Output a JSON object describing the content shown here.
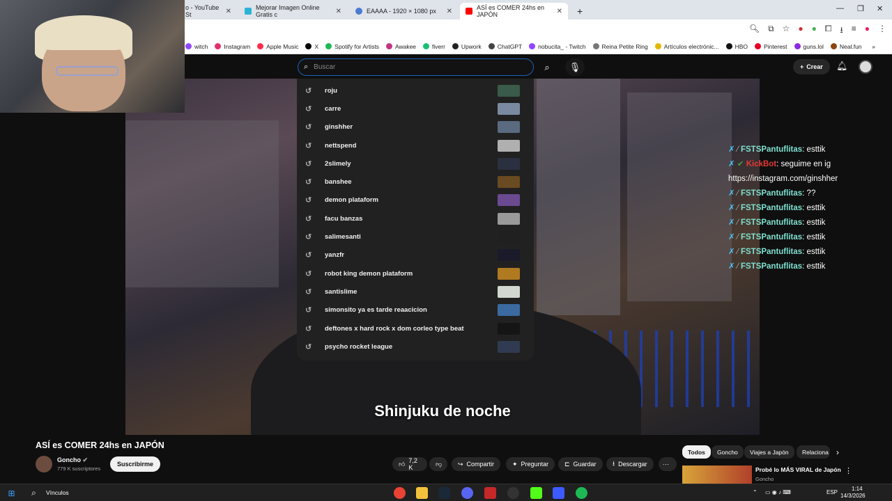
{
  "browser": {
    "tabs": [
      {
        "label": "o - YouTube St",
        "icon": "youtube-studio-icon",
        "color": "#ff0000"
      },
      {
        "label": "Mejorar Imagen Online Gratis c",
        "icon": "image-icon",
        "color": "#2ab3d6"
      },
      {
        "label": "EAAAA - 1920 × 1080 px",
        "icon": "globe-icon",
        "color": "#4a7bd4"
      },
      {
        "label": "ASÍ es COMER 24hs en JAPÓN",
        "icon": "youtube-icon",
        "color": "#ff0000"
      }
    ],
    "new_tab": "+",
    "bookmarks": [
      {
        "label": "witch",
        "color": "#9146ff"
      },
      {
        "label": "Instagram",
        "color": "#e1306c"
      },
      {
        "label": "Apple Music",
        "color": "#fa2d48"
      },
      {
        "label": "X",
        "color": "#000000"
      },
      {
        "label": "Spotify for Artists",
        "color": "#1db954"
      },
      {
        "label": "Awakee",
        "color": "#c13584"
      },
      {
        "label": "fiverr",
        "color": "#1dbf73"
      },
      {
        "label": "Upwork",
        "color": "#222222"
      },
      {
        "label": "ChatGPT",
        "color": "#444444"
      },
      {
        "label": "nobucita_ - Twitch",
        "color": "#9146ff"
      },
      {
        "label": "Reina Petite Ring",
        "color": "#777777"
      },
      {
        "label": "Artículos electrónic...",
        "color": "#e4b800"
      },
      {
        "label": "HBO",
        "color": "#111111"
      },
      {
        "label": "Pinterest",
        "color": "#e60023"
      },
      {
        "label": "guns.lol",
        "color": "#8a2be2"
      },
      {
        "label": "Neal.fun",
        "color": "#8b4513"
      }
    ]
  },
  "youtube": {
    "search_placeholder": "Buscar",
    "create_label": "Crear",
    "suggestions": [
      {
        "text": "roju",
        "thumb": "#3a5a4a"
      },
      {
        "text": "carre",
        "thumb": "#7a8aa0"
      },
      {
        "text": "ginshher",
        "thumb": "#5a6a80"
      },
      {
        "text": "nettspend",
        "thumb": "#b0b0b0"
      },
      {
        "text": "2slimely",
        "thumb": "#2a3040"
      },
      {
        "text": "banshee",
        "thumb": "#6a4a20"
      },
      {
        "text": "demon plataform",
        "thumb": "#6a4a90"
      },
      {
        "text": "facu banzas",
        "thumb": "#9a9a9a"
      },
      {
        "text": "salimesanti",
        "thumb": "#202020"
      },
      {
        "text": "yanzfr",
        "thumb": "#1a1a2a"
      },
      {
        "text": "robot king demon plataform",
        "thumb": "#b07a20"
      },
      {
        "text": "santislime",
        "thumb": "#d0d8d0"
      },
      {
        "text": "simonsito ya es tarde reaacicion",
        "thumb": "#3a6aa0"
      },
      {
        "text": "deftones x hard rock x dom corleo type beat",
        "thumb": "#151515"
      },
      {
        "text": "psycho rocket league",
        "thumb": "#303a50"
      }
    ],
    "caption": "Shinjuku de noche",
    "chat": [
      {
        "user": "FSTSPantuflitas",
        "msg": "esttik"
      },
      {
        "user": "KickBot",
        "msg": "seguime en ig",
        "link": "https://instagram.com/ginshher",
        "bot": true
      },
      {
        "user": "FSTSPantuflitas",
        "msg": "??"
      },
      {
        "user": "FSTSPantuflitas",
        "msg": "esttik"
      },
      {
        "user": "FSTSPantuflitas",
        "msg": "esttik"
      },
      {
        "user": "FSTSPantuflitas",
        "msg": "esttik"
      },
      {
        "user": "FSTSPantuflitas",
        "msg": "esttik"
      },
      {
        "user": "FSTSPantuflitas",
        "msg": "esttik"
      }
    ],
    "video_title": "ASÍ es COMER 24hs en JAPÓN",
    "channel": "Goncho",
    "subscribers": "779 K suscriptores",
    "subscribe_label": "Suscribirme",
    "likes": "7,2 K",
    "share_label": "Compartir",
    "ask_label": "Preguntar",
    "save_label": "Guardar",
    "download_label": "Descargar",
    "more_label": "···",
    "chips": [
      "Todos",
      "Goncho",
      "Viajes a Japón",
      "Relaciona"
    ],
    "rec_title": "Probé lo MÁS VIRAL de Japón",
    "rec_channel": "Goncho"
  },
  "taskbar": {
    "search_label": "Vínculos",
    "lang": "ESP",
    "time": "1:14",
    "date": "14/3/2026"
  }
}
